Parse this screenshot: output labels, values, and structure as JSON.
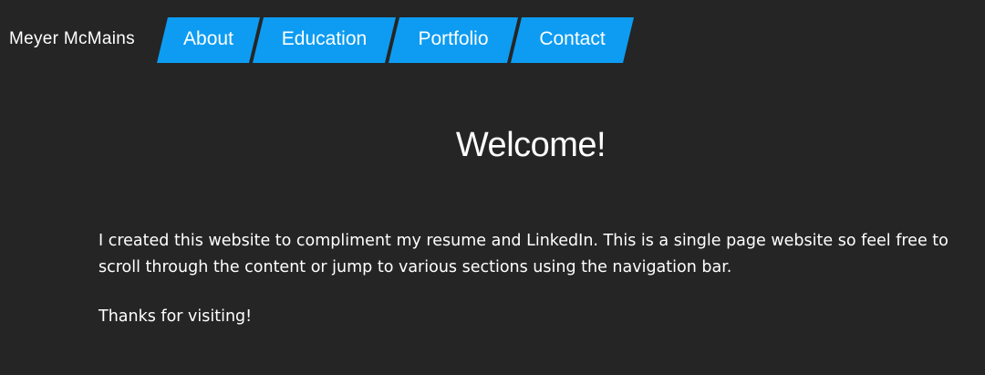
{
  "theme": {
    "background": "#252525",
    "accent": "#0d9cf2",
    "text": "#ffffff"
  },
  "header": {
    "brand": "Meyer McMains",
    "nav": [
      {
        "label": "About"
      },
      {
        "label": "Education"
      },
      {
        "label": "Portfolio"
      },
      {
        "label": "Contact"
      }
    ]
  },
  "main": {
    "title": "Welcome!",
    "intro": "I created this website to compliment my resume and LinkedIn. This is a single page website so feel free to scroll through the content or jump to various sections using the navigation bar.",
    "closing": "Thanks for visiting!"
  }
}
